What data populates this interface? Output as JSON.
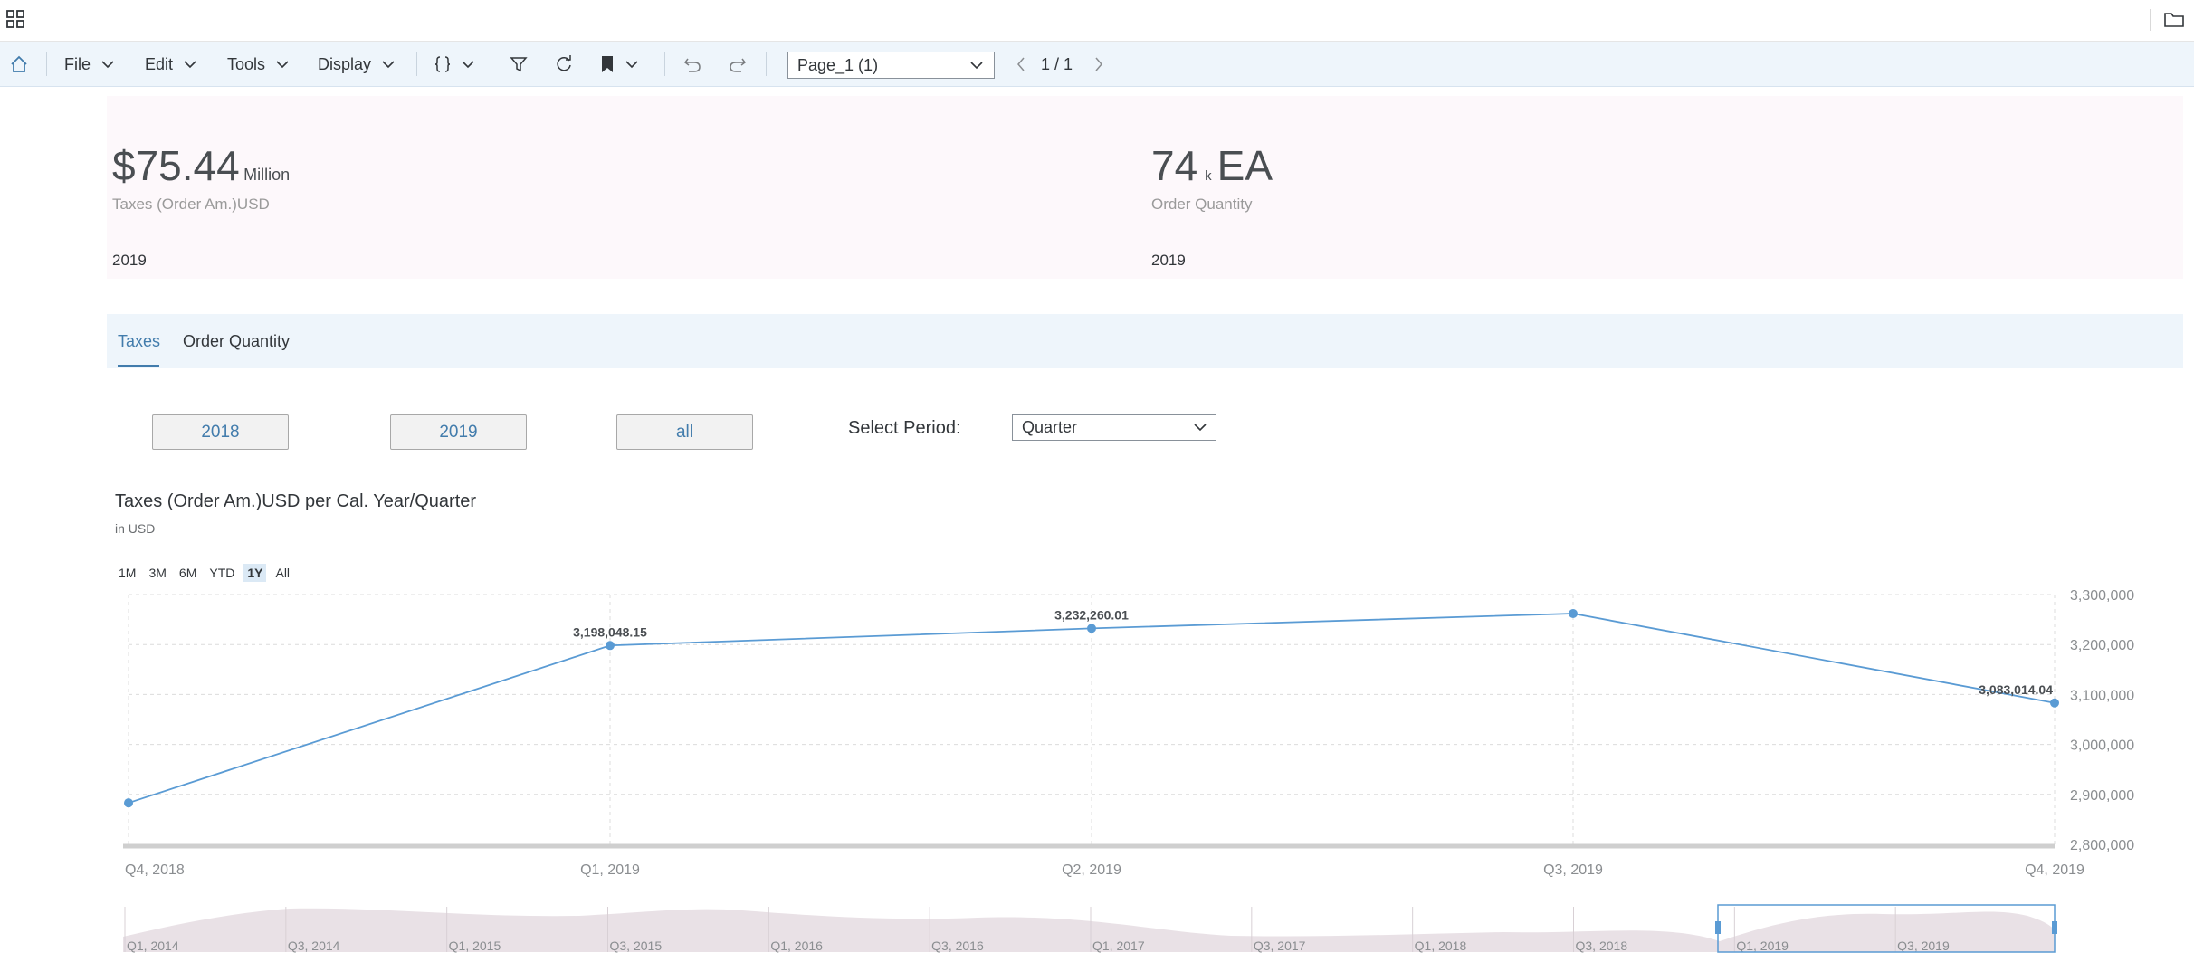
{
  "toolbar": {
    "file": "File",
    "edit": "Edit",
    "tools": "Tools",
    "display": "Display",
    "page_select": "Page_1 (1)",
    "pager": "1 / 1"
  },
  "kpis": [
    {
      "value": "$75.44",
      "scale": "Million",
      "label": "Taxes (Order Am.)USD",
      "year": "2019"
    },
    {
      "value": "74",
      "scale_prefix": "k",
      "scale": "EA",
      "label": "Order Quantity",
      "year": "2019"
    }
  ],
  "tabs": [
    "Taxes",
    "Order Quantity"
  ],
  "year_buttons": [
    "2018",
    "2019",
    "all"
  ],
  "period": {
    "label": "Select Period:",
    "value": "Quarter"
  },
  "chart_header": {
    "title": "Taxes (Order Am.)USD per Cal. Year/Quarter",
    "subtitle": "in USD",
    "range_buttons": [
      "1M",
      "3M",
      "6M",
      "YTD",
      "1Y",
      "All"
    ],
    "active_range": "1Y"
  },
  "colors": {
    "accent": "#427cac",
    "series": "#5a9bd4",
    "kpi_bg": "#fdf8fb",
    "toolbar_bg": "#eef5fb"
  },
  "chart_data": {
    "type": "line",
    "categories": [
      "Q4, 2018",
      "Q1, 2019",
      "Q2, 2019",
      "Q3, 2019",
      "Q4, 2019"
    ],
    "values": [
      2883000,
      3198048.15,
      3232260.01,
      3262000,
      3083014.04
    ],
    "data_labels": [
      "",
      "3,198,048.15",
      "3,232,260.01",
      "",
      "3,083,014.04"
    ],
    "y_ticks": [
      "2,800,000",
      "2,900,000",
      "3,000,000",
      "3,100,000",
      "3,200,000",
      "3,300,000"
    ],
    "ylim": [
      2800000,
      3300000
    ],
    "grid": true,
    "y_axis_position": "right",
    "navigator_labels": [
      "Q1, 2014",
      "Q3, 2014",
      "Q1, 2015",
      "Q3, 2015",
      "Q1, 2016",
      "Q3, 2016",
      "Q1, 2017",
      "Q3, 2017",
      "Q1, 2018",
      "Q3, 2018",
      "Q1, 2019",
      "Q3, 2019"
    ]
  }
}
